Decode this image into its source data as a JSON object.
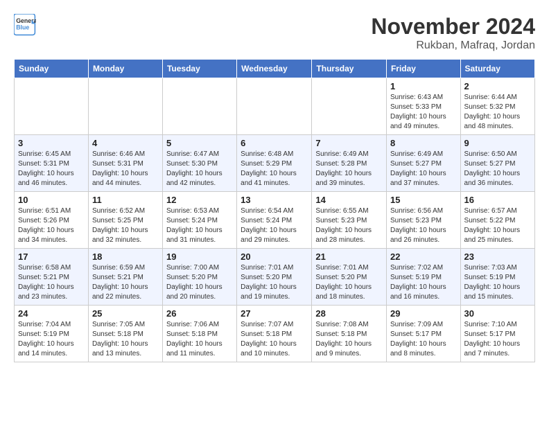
{
  "header": {
    "logo_line1": "General",
    "logo_line2": "Blue",
    "month": "November 2024",
    "location": "Rukban, Mafraq, Jordan"
  },
  "weekdays": [
    "Sunday",
    "Monday",
    "Tuesday",
    "Wednesday",
    "Thursday",
    "Friday",
    "Saturday"
  ],
  "weeks": [
    [
      {
        "day": "",
        "info": ""
      },
      {
        "day": "",
        "info": ""
      },
      {
        "day": "",
        "info": ""
      },
      {
        "day": "",
        "info": ""
      },
      {
        "day": "",
        "info": ""
      },
      {
        "day": "1",
        "info": "Sunrise: 6:43 AM\nSunset: 5:33 PM\nDaylight: 10 hours\nand 49 minutes."
      },
      {
        "day": "2",
        "info": "Sunrise: 6:44 AM\nSunset: 5:32 PM\nDaylight: 10 hours\nand 48 minutes."
      }
    ],
    [
      {
        "day": "3",
        "info": "Sunrise: 6:45 AM\nSunset: 5:31 PM\nDaylight: 10 hours\nand 46 minutes."
      },
      {
        "day": "4",
        "info": "Sunrise: 6:46 AM\nSunset: 5:31 PM\nDaylight: 10 hours\nand 44 minutes."
      },
      {
        "day": "5",
        "info": "Sunrise: 6:47 AM\nSunset: 5:30 PM\nDaylight: 10 hours\nand 42 minutes."
      },
      {
        "day": "6",
        "info": "Sunrise: 6:48 AM\nSunset: 5:29 PM\nDaylight: 10 hours\nand 41 minutes."
      },
      {
        "day": "7",
        "info": "Sunrise: 6:49 AM\nSunset: 5:28 PM\nDaylight: 10 hours\nand 39 minutes."
      },
      {
        "day": "8",
        "info": "Sunrise: 6:49 AM\nSunset: 5:27 PM\nDaylight: 10 hours\nand 37 minutes."
      },
      {
        "day": "9",
        "info": "Sunrise: 6:50 AM\nSunset: 5:27 PM\nDaylight: 10 hours\nand 36 minutes."
      }
    ],
    [
      {
        "day": "10",
        "info": "Sunrise: 6:51 AM\nSunset: 5:26 PM\nDaylight: 10 hours\nand 34 minutes."
      },
      {
        "day": "11",
        "info": "Sunrise: 6:52 AM\nSunset: 5:25 PM\nDaylight: 10 hours\nand 32 minutes."
      },
      {
        "day": "12",
        "info": "Sunrise: 6:53 AM\nSunset: 5:24 PM\nDaylight: 10 hours\nand 31 minutes."
      },
      {
        "day": "13",
        "info": "Sunrise: 6:54 AM\nSunset: 5:24 PM\nDaylight: 10 hours\nand 29 minutes."
      },
      {
        "day": "14",
        "info": "Sunrise: 6:55 AM\nSunset: 5:23 PM\nDaylight: 10 hours\nand 28 minutes."
      },
      {
        "day": "15",
        "info": "Sunrise: 6:56 AM\nSunset: 5:23 PM\nDaylight: 10 hours\nand 26 minutes."
      },
      {
        "day": "16",
        "info": "Sunrise: 6:57 AM\nSunset: 5:22 PM\nDaylight: 10 hours\nand 25 minutes."
      }
    ],
    [
      {
        "day": "17",
        "info": "Sunrise: 6:58 AM\nSunset: 5:21 PM\nDaylight: 10 hours\nand 23 minutes."
      },
      {
        "day": "18",
        "info": "Sunrise: 6:59 AM\nSunset: 5:21 PM\nDaylight: 10 hours\nand 22 minutes."
      },
      {
        "day": "19",
        "info": "Sunrise: 7:00 AM\nSunset: 5:20 PM\nDaylight: 10 hours\nand 20 minutes."
      },
      {
        "day": "20",
        "info": "Sunrise: 7:01 AM\nSunset: 5:20 PM\nDaylight: 10 hours\nand 19 minutes."
      },
      {
        "day": "21",
        "info": "Sunrise: 7:01 AM\nSunset: 5:20 PM\nDaylight: 10 hours\nand 18 minutes."
      },
      {
        "day": "22",
        "info": "Sunrise: 7:02 AM\nSunset: 5:19 PM\nDaylight: 10 hours\nand 16 minutes."
      },
      {
        "day": "23",
        "info": "Sunrise: 7:03 AM\nSunset: 5:19 PM\nDaylight: 10 hours\nand 15 minutes."
      }
    ],
    [
      {
        "day": "24",
        "info": "Sunrise: 7:04 AM\nSunset: 5:19 PM\nDaylight: 10 hours\nand 14 minutes."
      },
      {
        "day": "25",
        "info": "Sunrise: 7:05 AM\nSunset: 5:18 PM\nDaylight: 10 hours\nand 13 minutes."
      },
      {
        "day": "26",
        "info": "Sunrise: 7:06 AM\nSunset: 5:18 PM\nDaylight: 10 hours\nand 11 minutes."
      },
      {
        "day": "27",
        "info": "Sunrise: 7:07 AM\nSunset: 5:18 PM\nDaylight: 10 hours\nand 10 minutes."
      },
      {
        "day": "28",
        "info": "Sunrise: 7:08 AM\nSunset: 5:18 PM\nDaylight: 10 hours\nand 9 minutes."
      },
      {
        "day": "29",
        "info": "Sunrise: 7:09 AM\nSunset: 5:17 PM\nDaylight: 10 hours\nand 8 minutes."
      },
      {
        "day": "30",
        "info": "Sunrise: 7:10 AM\nSunset: 5:17 PM\nDaylight: 10 hours\nand 7 minutes."
      }
    ]
  ]
}
